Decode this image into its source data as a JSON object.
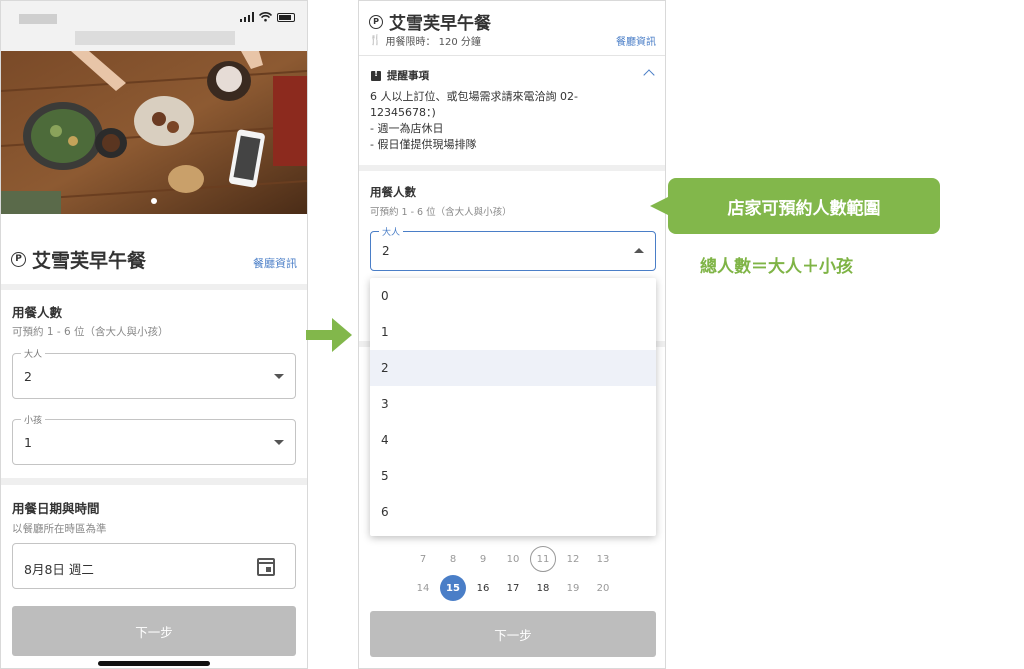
{
  "colors": {
    "accent_green": "#82b74b",
    "link_blue": "#4a7ec7",
    "disabled_button": "#bdbdbd",
    "selected_day": "#4a7ec7"
  },
  "left": {
    "restaurant_name": "艾雪芙早午餐",
    "restaurant_info_link": "餐廳資訊",
    "party": {
      "title": "用餐人數",
      "subtitle": "可預約 1 - 6 位（含大人與小孩）",
      "adults_label": "大人",
      "adults_value": "2",
      "children_label": "小孩",
      "children_value": "1"
    },
    "datetime": {
      "title": "用餐日期與時間",
      "subtitle": "以餐廳所在時區為準",
      "date_value": "8月8日 週二"
    },
    "next_button": "下一步"
  },
  "right": {
    "restaurant_name": "艾雪芙早午餐",
    "time_limit": "用餐限時： 120 分鐘",
    "restaurant_info_link": "餐廳資訊",
    "notice_title": "提醒事項",
    "notice_lines": [
      "6 人以上訂位、或包場需求請來電洽詢 02-",
      "12345678：)",
      "- 週一為店休日",
      "- 假日僅提供現場排隊"
    ],
    "party": {
      "title": "用餐人數",
      "subtitle": "可預約 1 - 6 位（含大人與小孩）",
      "adults_label": "大人",
      "adults_value": "2"
    },
    "dropdown_options": [
      "0",
      "1",
      "2",
      "3",
      "4",
      "5",
      "6"
    ],
    "dropdown_selected": "2",
    "calendar_rows": [
      [
        "7",
        "8",
        "9",
        "10",
        "11",
        "12",
        "13"
      ],
      [
        "14",
        "15",
        "16",
        "17",
        "18",
        "19",
        "20"
      ]
    ],
    "calendar_today": "11",
    "calendar_selected": "15",
    "next_button": "下一步"
  },
  "callout": {
    "text": "店家可預約人數範圍",
    "formula": "總人數＝大人＋小孩"
  }
}
